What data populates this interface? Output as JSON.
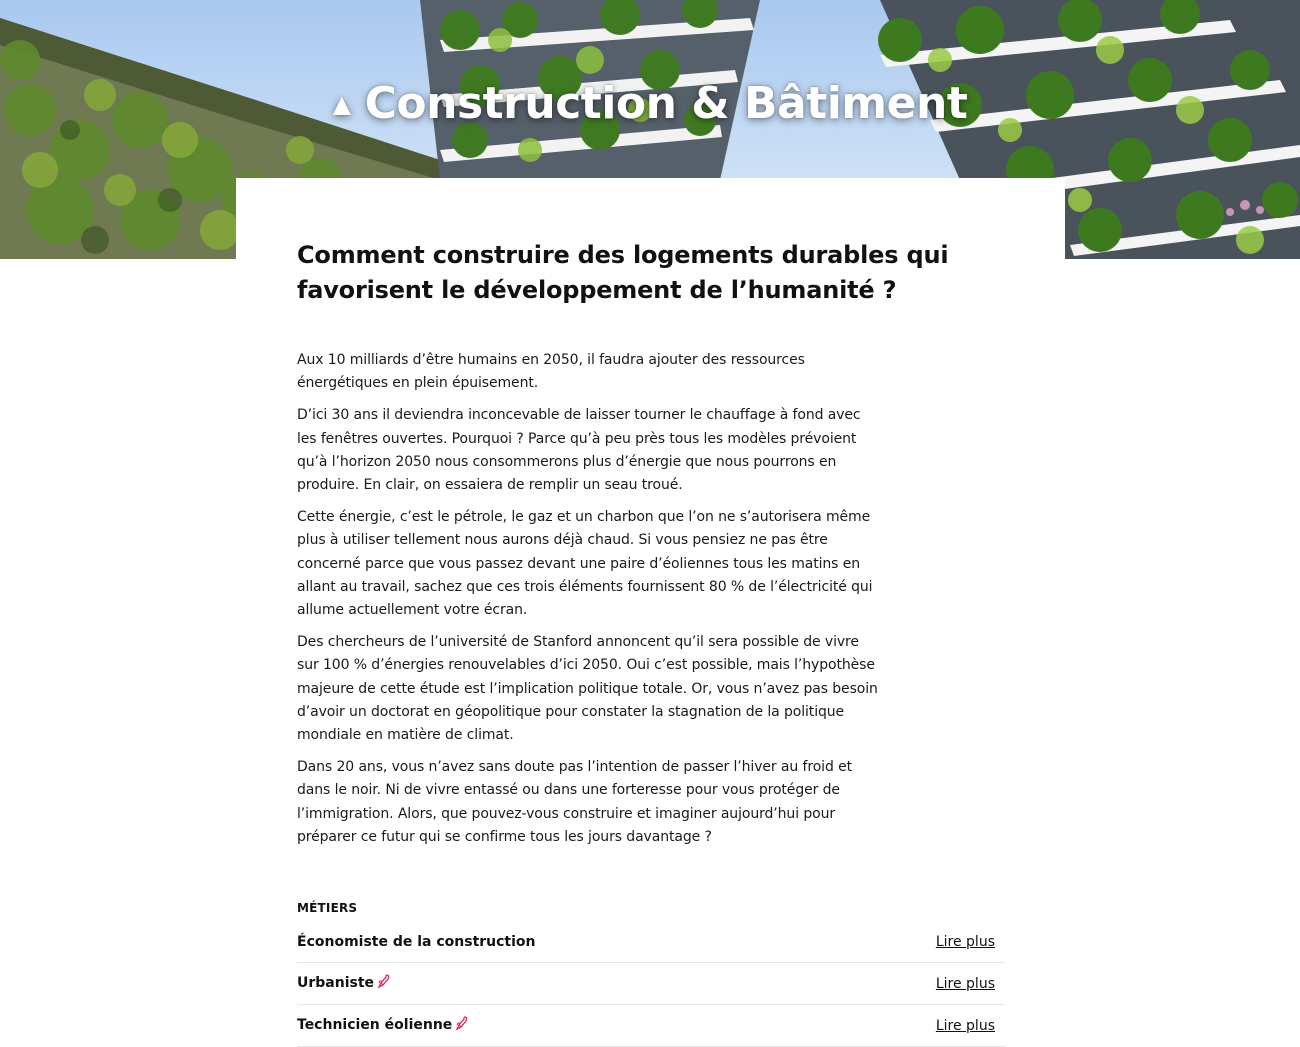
{
  "hero": {
    "icon": "triangle-up-icon",
    "title": "Construction & Bâtiment"
  },
  "article": {
    "heading": "Comment construire des logements durables qui favorisent le développement de l’humanité ?",
    "paragraphs": [
      "Aux 10 milliards d’être humains en 2050, il faudra ajouter des ressources énergétiques en plein épuisement.",
      "D’ici 30 ans il deviendra inconcevable de laisser tourner le chauffage à fond avec les fenêtres ouvertes. Pourquoi ? Parce qu’à peu près tous les modèles prévoient qu’à l’horizon 2050 nous consommerons plus d’énergie que nous pourrons en produire. En clair, on essaiera de remplir un seau troué.",
      "Cette énergie, c’est le pétrole, le gaz et un charbon que l’on ne s’autorisera même plus à utiliser tellement nous aurons déjà chaud. Si vous pensiez ne pas être concerné parce que vous passez devant une paire d’éoliennes tous les matins en allant au travail, sachez que ces trois éléments fournissent 80 % de l’électricité qui allume actuellement votre écran.",
      "Des chercheurs de l’université de Stanford annoncent qu’il sera possible de vivre sur 100 % d’énergies renouvelables d’ici 2050. Oui c’est possible, mais l’hypothèse majeure de cette étude est l’implication politique totale. Or, vous n’avez pas besoin d’avoir un doctorat en géopolitique pour constater la stagnation de la politique mondiale en matière de climat.",
      "Dans 20 ans, vous n’avez sans doute pas l’intention de passer l’hiver au froid et dans le noir. Ni de vivre entassé ou dans une forteresse pour vous protéger de l’immigration. Alors, que pouvez-vous construire et imaginer aujourd’hui pour préparer ce futur qui se confirme tous les jours davantage ?"
    ]
  },
  "jobs": {
    "section_label": "MÉTIERS",
    "items": [
      {
        "name": "Économiste de la construction",
        "link": "Lire plus",
        "icon": ""
      },
      {
        "name": "Urbaniste",
        "link": "Lire plus",
        "icon": "rocket-icon"
      },
      {
        "name": "Technicien éolienne",
        "link": "Lire plus",
        "icon": "rocket-icon"
      }
    ]
  },
  "colors": {
    "accent_icon": "#e0245e",
    "text": "#111111",
    "divider": "#e6e6e6"
  }
}
